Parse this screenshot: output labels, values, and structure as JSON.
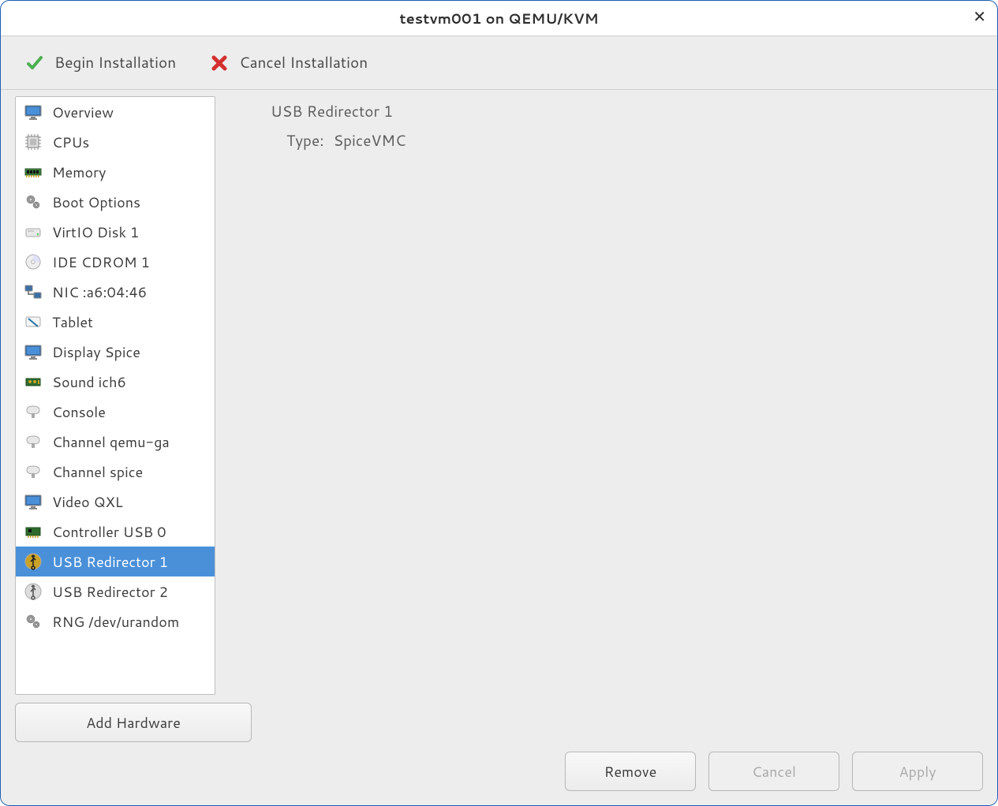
{
  "title": "testvm001 on QEMU/KVM",
  "toolbar": {
    "begin_label": "Begin Installation",
    "cancel_label": "Cancel Installation"
  },
  "sidebar": {
    "items": [
      {
        "icon": "monitor",
        "label": "Overview"
      },
      {
        "icon": "cpu",
        "label": "CPUs"
      },
      {
        "icon": "memory",
        "label": "Memory"
      },
      {
        "icon": "gears",
        "label": "Boot Options"
      },
      {
        "icon": "disk",
        "label": "VirtIO Disk 1"
      },
      {
        "icon": "cdrom",
        "label": "IDE CDROM 1"
      },
      {
        "icon": "nic",
        "label": "NIC :a6:04:46"
      },
      {
        "icon": "tablet",
        "label": "Tablet"
      },
      {
        "icon": "monitor",
        "label": "Display Spice"
      },
      {
        "icon": "sound",
        "label": "Sound ich6"
      },
      {
        "icon": "serial",
        "label": "Console"
      },
      {
        "icon": "serial",
        "label": "Channel qemu-ga"
      },
      {
        "icon": "serial",
        "label": "Channel spice"
      },
      {
        "icon": "monitor",
        "label": "Video QXL"
      },
      {
        "icon": "pci",
        "label": "Controller USB 0"
      },
      {
        "icon": "usb",
        "label": "USB Redirector 1"
      },
      {
        "icon": "usb",
        "label": "USB Redirector 2"
      },
      {
        "icon": "gears",
        "label": "RNG /dev/urandom"
      }
    ],
    "selected_index": 15
  },
  "detail": {
    "title": "USB Redirector 1",
    "type_label": "Type:",
    "type_value": "SpiceVMC"
  },
  "buttons": {
    "add_hardware": "Add Hardware",
    "remove": "Remove",
    "cancel": "Cancel",
    "apply": "Apply"
  },
  "colors": {
    "selection": "#4a90d9",
    "window_border": "#1a5fb4",
    "chrome_bg": "#ededed"
  }
}
